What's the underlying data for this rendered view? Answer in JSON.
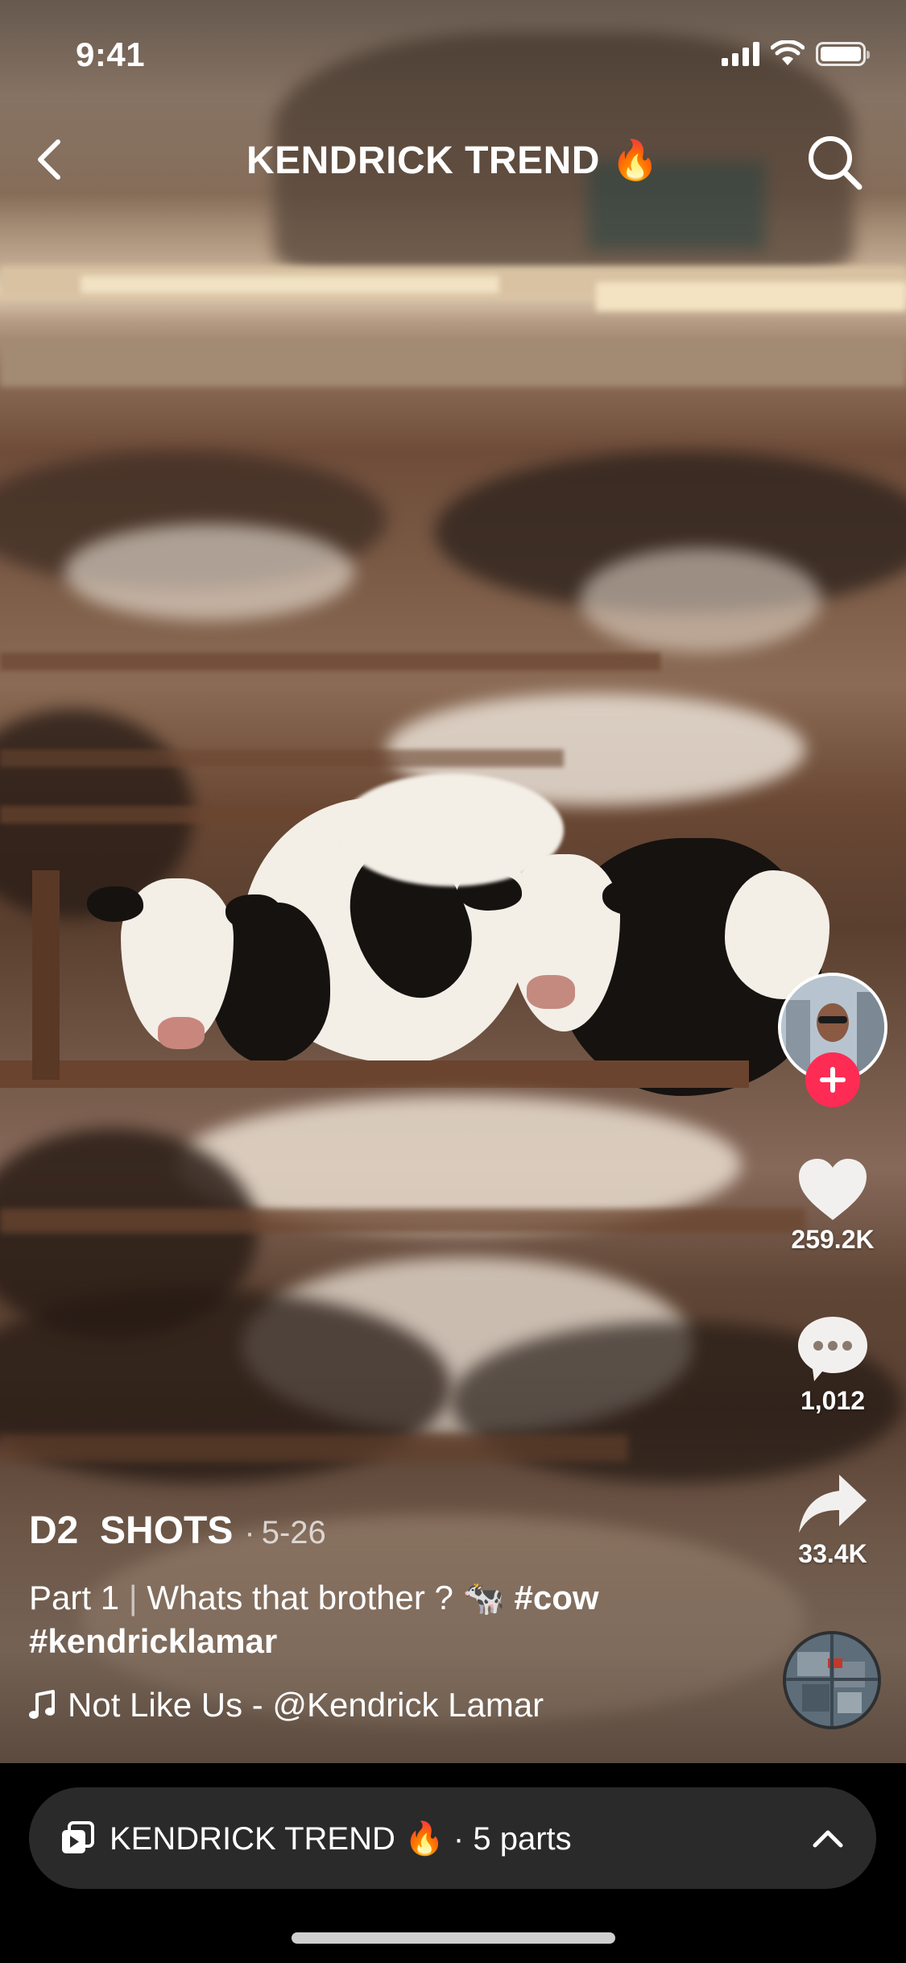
{
  "status_bar": {
    "time": "9:41",
    "icons": [
      "cellular-signal-icon",
      "wifi-icon",
      "battery-icon"
    ]
  },
  "header": {
    "title": "KENDRICK TREND 🔥",
    "back_icon": "chevron-left-icon",
    "search_icon": "search-icon"
  },
  "actions": {
    "follow_icon": "plus-icon",
    "likes": "259.2K",
    "comments": "1,012",
    "shares": "33.4K",
    "icons": [
      "heart-icon",
      "comment-icon",
      "share-icon"
    ]
  },
  "post": {
    "author": "D2  SHOTS",
    "separator": "·",
    "date": "5-26",
    "description_part": "Part 1",
    "description_divider": "|",
    "description_text": "Whats that brother ? 🐄",
    "hashtags": [
      "#cow",
      "#kendricklamar"
    ],
    "music": "Not Like Us - @Kendrick Lamar",
    "music_icon": "music-note-icon"
  },
  "playlist": {
    "title": "KENDRICK TREND 🔥",
    "separator": "·",
    "parts_label": "5 parts",
    "icon": "playlist-icon",
    "expand_icon": "chevron-up-icon"
  },
  "colors": {
    "accent": "#fe2c55",
    "playlist_bar": "#2a2a2a",
    "text": "#ffffff"
  }
}
